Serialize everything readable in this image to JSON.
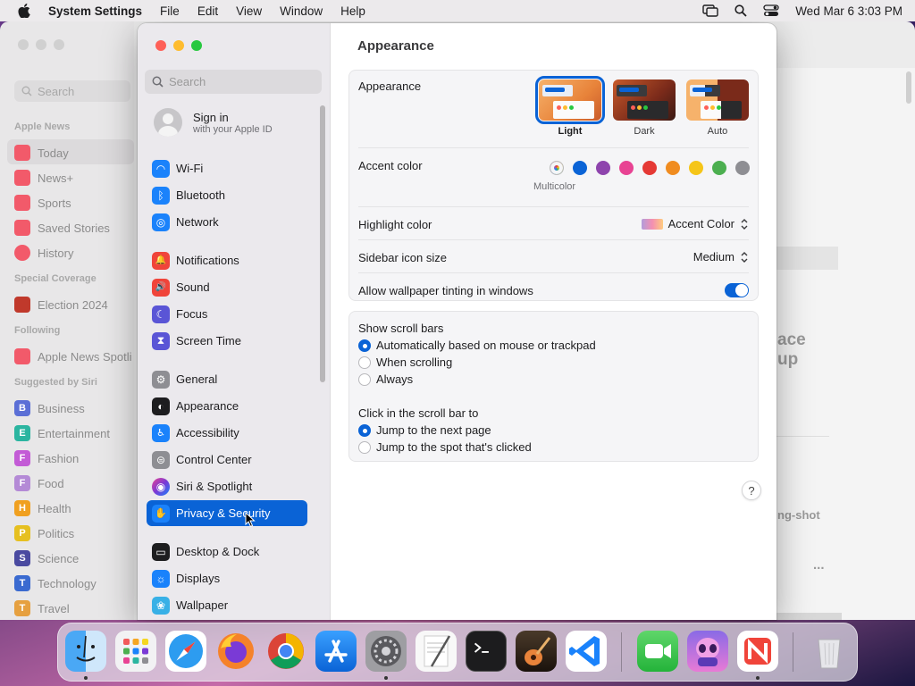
{
  "menubar": {
    "app_name": "System Settings",
    "menus": [
      "File",
      "Edit",
      "View",
      "Window",
      "Help"
    ],
    "clock": "Wed Mar 6  3:03 PM"
  },
  "news_window": {
    "search_placeholder": "Search",
    "sections": [
      "Apple News",
      "Special Coverage",
      "Following",
      "Suggested by Siri"
    ],
    "items": [
      {
        "label": "Today",
        "letter": "",
        "color": "#f25a6a"
      },
      {
        "label": "News+",
        "letter": "",
        "color": "#f25a6a"
      },
      {
        "label": "Sports",
        "letter": "",
        "color": "#f25a6a"
      },
      {
        "label": "Saved Stories",
        "letter": "",
        "color": "#f25a6a"
      },
      {
        "label": "History",
        "letter": "",
        "color": "#f25a6a"
      },
      {
        "label": "Election 2024",
        "letter": "",
        "color": "#c0392b"
      },
      {
        "label": "Apple News Spotli",
        "letter": "",
        "color": "#f25a6a"
      },
      {
        "label": "Business",
        "letter": "B",
        "color": "#5b6fd6"
      },
      {
        "label": "Entertainment",
        "letter": "E",
        "color": "#2bb5a0"
      },
      {
        "label": "Fashion",
        "letter": "F",
        "color": "#c35bd6"
      },
      {
        "label": "Food",
        "letter": "F",
        "color": "#b48ad6"
      },
      {
        "label": "Health",
        "letter": "H",
        "color": "#f0a020"
      },
      {
        "label": "Politics",
        "letter": "P",
        "color": "#e6c020"
      },
      {
        "label": "Science",
        "letter": "S",
        "color": "#4a4aa0"
      },
      {
        "label": "Technology",
        "letter": "T",
        "color": "#3a6ad0"
      },
      {
        "label": "Travel",
        "letter": "T",
        "color": "#e6a040"
      }
    ],
    "fragments": [
      "ace",
      "up",
      "ng-shot",
      "..."
    ]
  },
  "sidebar": {
    "search_placeholder": "Search",
    "signin": {
      "title": "Sign in",
      "subtitle": "with your Apple ID"
    },
    "items": [
      {
        "label": "Wi-Fi",
        "icon": "wifi-icon",
        "color": "#1a82fb",
        "glyph": "◠"
      },
      {
        "label": "Bluetooth",
        "icon": "bluetooth-icon",
        "color": "#1a82fb",
        "glyph": "ᛒ"
      },
      {
        "label": "Network",
        "icon": "globe-icon",
        "color": "#1a82fb",
        "glyph": "◎"
      },
      {
        "label": "Notifications",
        "icon": "bell-icon",
        "color": "#f0443a",
        "glyph": "🔔"
      },
      {
        "label": "Sound",
        "icon": "speaker-icon",
        "color": "#f0443a",
        "glyph": "🔊"
      },
      {
        "label": "Focus",
        "icon": "moon-icon",
        "color": "#5a55d6",
        "glyph": "☾"
      },
      {
        "label": "Screen Time",
        "icon": "hourglass-icon",
        "color": "#5a55d6",
        "glyph": "⧗"
      },
      {
        "label": "General",
        "icon": "gear-icon",
        "color": "#8e8e93",
        "glyph": "⚙"
      },
      {
        "label": "Appearance",
        "icon": "appearance-icon",
        "color": "#1d1d1f",
        "glyph": "◐"
      },
      {
        "label": "Accessibility",
        "icon": "accessibility-icon",
        "color": "#1a82fb",
        "glyph": "♿"
      },
      {
        "label": "Control Center",
        "icon": "control-center-icon",
        "color": "#8e8e93",
        "glyph": "⊜"
      },
      {
        "label": "Siri & Spotlight",
        "icon": "siri-icon",
        "color": "#7a3ad6",
        "glyph": "◉"
      },
      {
        "label": "Privacy & Security",
        "icon": "hand-icon",
        "color": "#1a82fb",
        "glyph": "✋"
      },
      {
        "label": "Desktop & Dock",
        "icon": "dock-icon",
        "color": "#1d1d1f",
        "glyph": "▭"
      },
      {
        "label": "Displays",
        "icon": "display-icon",
        "color": "#1a82fb",
        "glyph": "☼"
      },
      {
        "label": "Wallpaper",
        "icon": "wallpaper-icon",
        "color": "#38b0e6",
        "glyph": "❀"
      }
    ]
  },
  "main": {
    "title": "Appearance",
    "appearance": {
      "label": "Appearance",
      "options": [
        "Light",
        "Dark",
        "Auto"
      ],
      "selected": "Light"
    },
    "accent": {
      "label": "Accent color",
      "caption": "Multicolor",
      "colors": [
        "#9b59b6",
        "#0a63d6",
        "#8e44ad",
        "#e84393",
        "#e53935",
        "#f08c20",
        "#f5c518",
        "#4caf50",
        "#8e8e93"
      ]
    },
    "highlight": {
      "label": "Highlight color",
      "value": "Accent Color"
    },
    "sidebar_icon": {
      "label": "Sidebar icon size",
      "value": "Medium"
    },
    "tinting": {
      "label": "Allow wallpaper tinting in windows",
      "on": true
    },
    "scroll_bars": {
      "label": "Show scroll bars",
      "options": [
        "Automatically based on mouse or trackpad",
        "When scrolling",
        "Always"
      ],
      "selected": 0
    },
    "click_scroll": {
      "label": "Click in the scroll bar to",
      "options": [
        "Jump to the next page",
        "Jump to the spot that's clicked"
      ],
      "selected": 0
    },
    "help": "?"
  },
  "dock": {
    "apps": [
      "finder-icon",
      "launchpad-icon",
      "safari-icon",
      "firefox-icon",
      "chrome-icon",
      "app-store-icon",
      "system-settings-icon",
      "textedit-icon",
      "terminal-icon",
      "garageband-icon",
      "vscode-icon",
      "facetime-icon",
      "alien-app-icon",
      "news-icon",
      "trash-icon"
    ]
  }
}
